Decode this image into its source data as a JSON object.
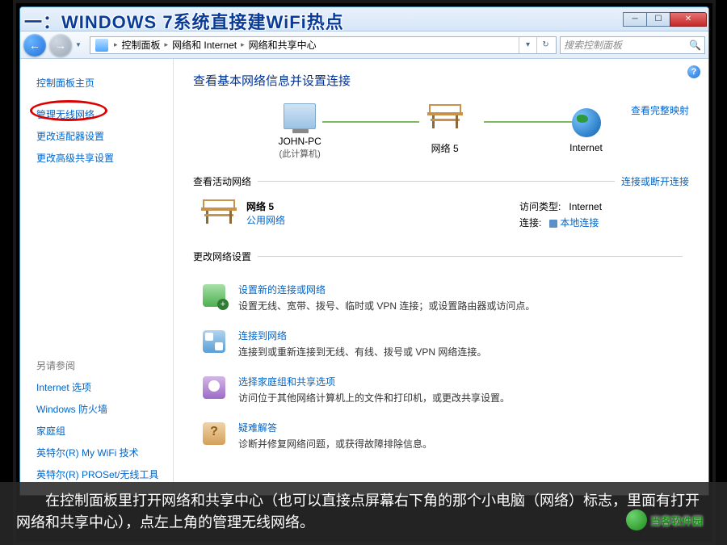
{
  "headline": "一：WINDOWS 7系统直接建WiFi热点",
  "window": {
    "buttons": {
      "min": "─",
      "max": "☐",
      "close": "✕"
    },
    "nav": {
      "back": "←",
      "fwd": "→",
      "dd": "▼"
    },
    "breadcrumb": {
      "root_icon": "control-panel-icon",
      "items": [
        "控制面板",
        "网络和 Internet",
        "网络和共享中心"
      ],
      "sep": "▸",
      "refresh": "↻"
    },
    "search": {
      "placeholder": "搜索控制面板",
      "icon": "🔍"
    }
  },
  "sidebar": {
    "home": "控制面板主页",
    "links": [
      "管理无线网络",
      "更改适配器设置",
      "更改高级共享设置"
    ],
    "see_also_heading": "另请参阅",
    "see_also": [
      "Internet 选项",
      "Windows 防火墙",
      "家庭组",
      "英特尔(R) My WiFi 技术",
      "英特尔(R) PROSet/无线工具"
    ]
  },
  "main": {
    "help": "?",
    "title": "查看基本网络信息并设置连接",
    "map": {
      "full_map_link": "查看完整映射",
      "nodes": [
        {
          "label": "JOHN-PC",
          "sublabel": "(此计算机)"
        },
        {
          "label": "网络  5",
          "sublabel": ""
        },
        {
          "label": "Internet",
          "sublabel": ""
        }
      ]
    },
    "active_section": {
      "heading": "查看活动网络",
      "link": "连接或断开连接",
      "name": "网络  5",
      "type": "公用网络",
      "right": {
        "access_label": "访问类型:",
        "access_value": "Internet",
        "conn_label": "连接:",
        "conn_value": "本地连接"
      }
    },
    "change_heading": "更改网络设置",
    "settings": [
      {
        "icon": "newconn",
        "title": "设置新的连接或网络",
        "desc": "设置无线、宽带、拨号、临时或 VPN 连接；或设置路由器或访问点。"
      },
      {
        "icon": "connect",
        "title": "连接到网络",
        "desc": "连接到或重新连接到无线、有线、拨号或 VPN 网络连接。"
      },
      {
        "icon": "homegroup",
        "title": "选择家庭组和共享选项",
        "desc": "访问位于其他网络计算机上的文件和打印机，或更改共享设置。"
      },
      {
        "icon": "diag",
        "title": "疑难解答",
        "desc": "诊断并修复网络问题，或获得故障排除信息。"
      }
    ]
  },
  "caption": "　　在控制面板里打开网络和共享中心（也可以直接点屏幕右下角的那个小电脑（网络）标志，里面有打开网络和共享中心），点左上角的管理无线网络。",
  "watermark": "当客软件园"
}
